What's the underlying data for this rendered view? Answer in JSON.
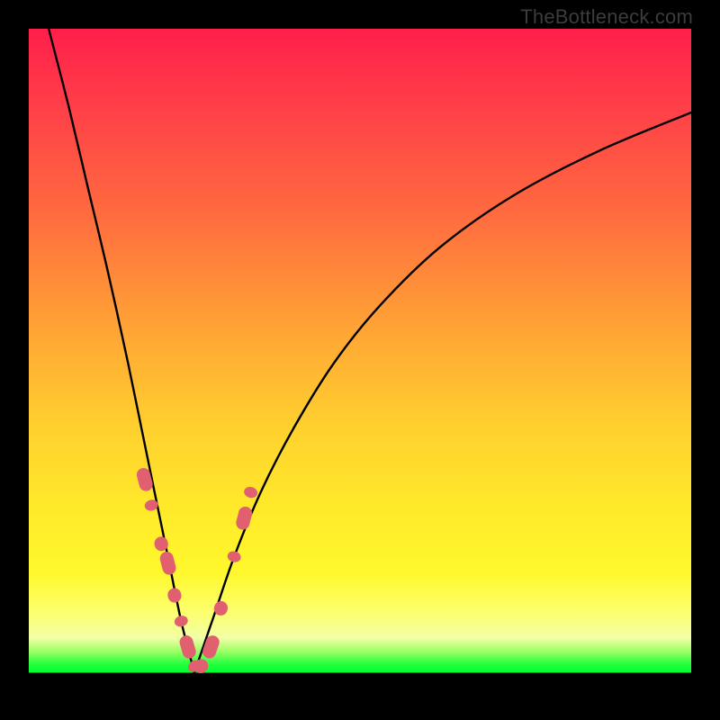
{
  "attribution": "TheBottleneck.com",
  "colors": {
    "background_frame": "#000000",
    "gradient_top": "#ff1f4a",
    "gradient_mid1": "#ff6b3f",
    "gradient_mid2": "#ffd02e",
    "gradient_mid3": "#fff82c",
    "gradient_green": "#00ff2f",
    "curve_stroke": "#000000",
    "marker_fill": "#e06070",
    "attribution_text": "#3c3c3c"
  },
  "chart_data": {
    "type": "line",
    "title": "",
    "xlabel": "",
    "ylabel": "",
    "xlim": [
      0,
      100
    ],
    "ylim": [
      0,
      100
    ],
    "note": "Axes are unlabeled; x and y expressed as 0–100 % of plot area. Curve is a V-shaped bottleneck profile with minimum (~0) near x≈25.",
    "series": [
      {
        "name": "bottleneck-curve-left",
        "x": [
          3,
          6,
          9,
          12,
          15,
          17,
          19,
          21,
          23,
          25
        ],
        "y": [
          100,
          88,
          75,
          62,
          48,
          38,
          28,
          18,
          8,
          0
        ]
      },
      {
        "name": "bottleneck-curve-right",
        "x": [
          25,
          28,
          31,
          35,
          40,
          46,
          53,
          62,
          73,
          86,
          100
        ],
        "y": [
          0,
          9,
          18,
          28,
          38,
          48,
          57,
          66,
          74,
          81,
          87
        ]
      }
    ],
    "markers": {
      "name": "highlighted-points",
      "description": "Salmon capsule-shaped markers clustered near the trough on both branches, roughly y in [0, 30].",
      "points": [
        {
          "x": 17.5,
          "y": 30
        },
        {
          "x": 18.5,
          "y": 26
        },
        {
          "x": 20.0,
          "y": 20
        },
        {
          "x": 21.0,
          "y": 17
        },
        {
          "x": 22.0,
          "y": 12
        },
        {
          "x": 23.0,
          "y": 8
        },
        {
          "x": 24.0,
          "y": 4
        },
        {
          "x": 25.0,
          "y": 1
        },
        {
          "x": 26.0,
          "y": 1
        },
        {
          "x": 27.5,
          "y": 4
        },
        {
          "x": 29.0,
          "y": 10
        },
        {
          "x": 31.0,
          "y": 18
        },
        {
          "x": 32.5,
          "y": 24
        },
        {
          "x": 33.5,
          "y": 28
        }
      ]
    }
  }
}
